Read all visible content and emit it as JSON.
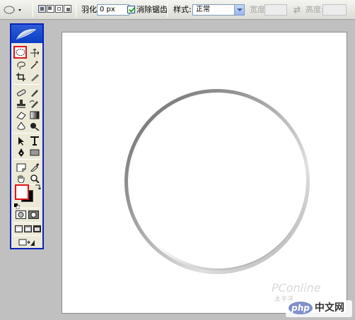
{
  "options_bar": {
    "feather_label": "羽化:",
    "feather_value": "0 px",
    "antialias_label": "消除锯齿",
    "antialias_checked": true,
    "style_label": "样式:",
    "style_value": "正常",
    "width_label": "宽度:",
    "height_label": "高度:",
    "width_value": "",
    "height_value": ""
  },
  "toolbox": {
    "active_tool": "elliptical-marquee",
    "foreground_color": "#ffffff",
    "background_color": "#000000"
  },
  "canvas": {
    "background": "#ffffff"
  },
  "watermark": {
    "text": "PConline",
    "sub": "太平洋"
  },
  "badge": {
    "logo": "php",
    "text": "中文网"
  }
}
